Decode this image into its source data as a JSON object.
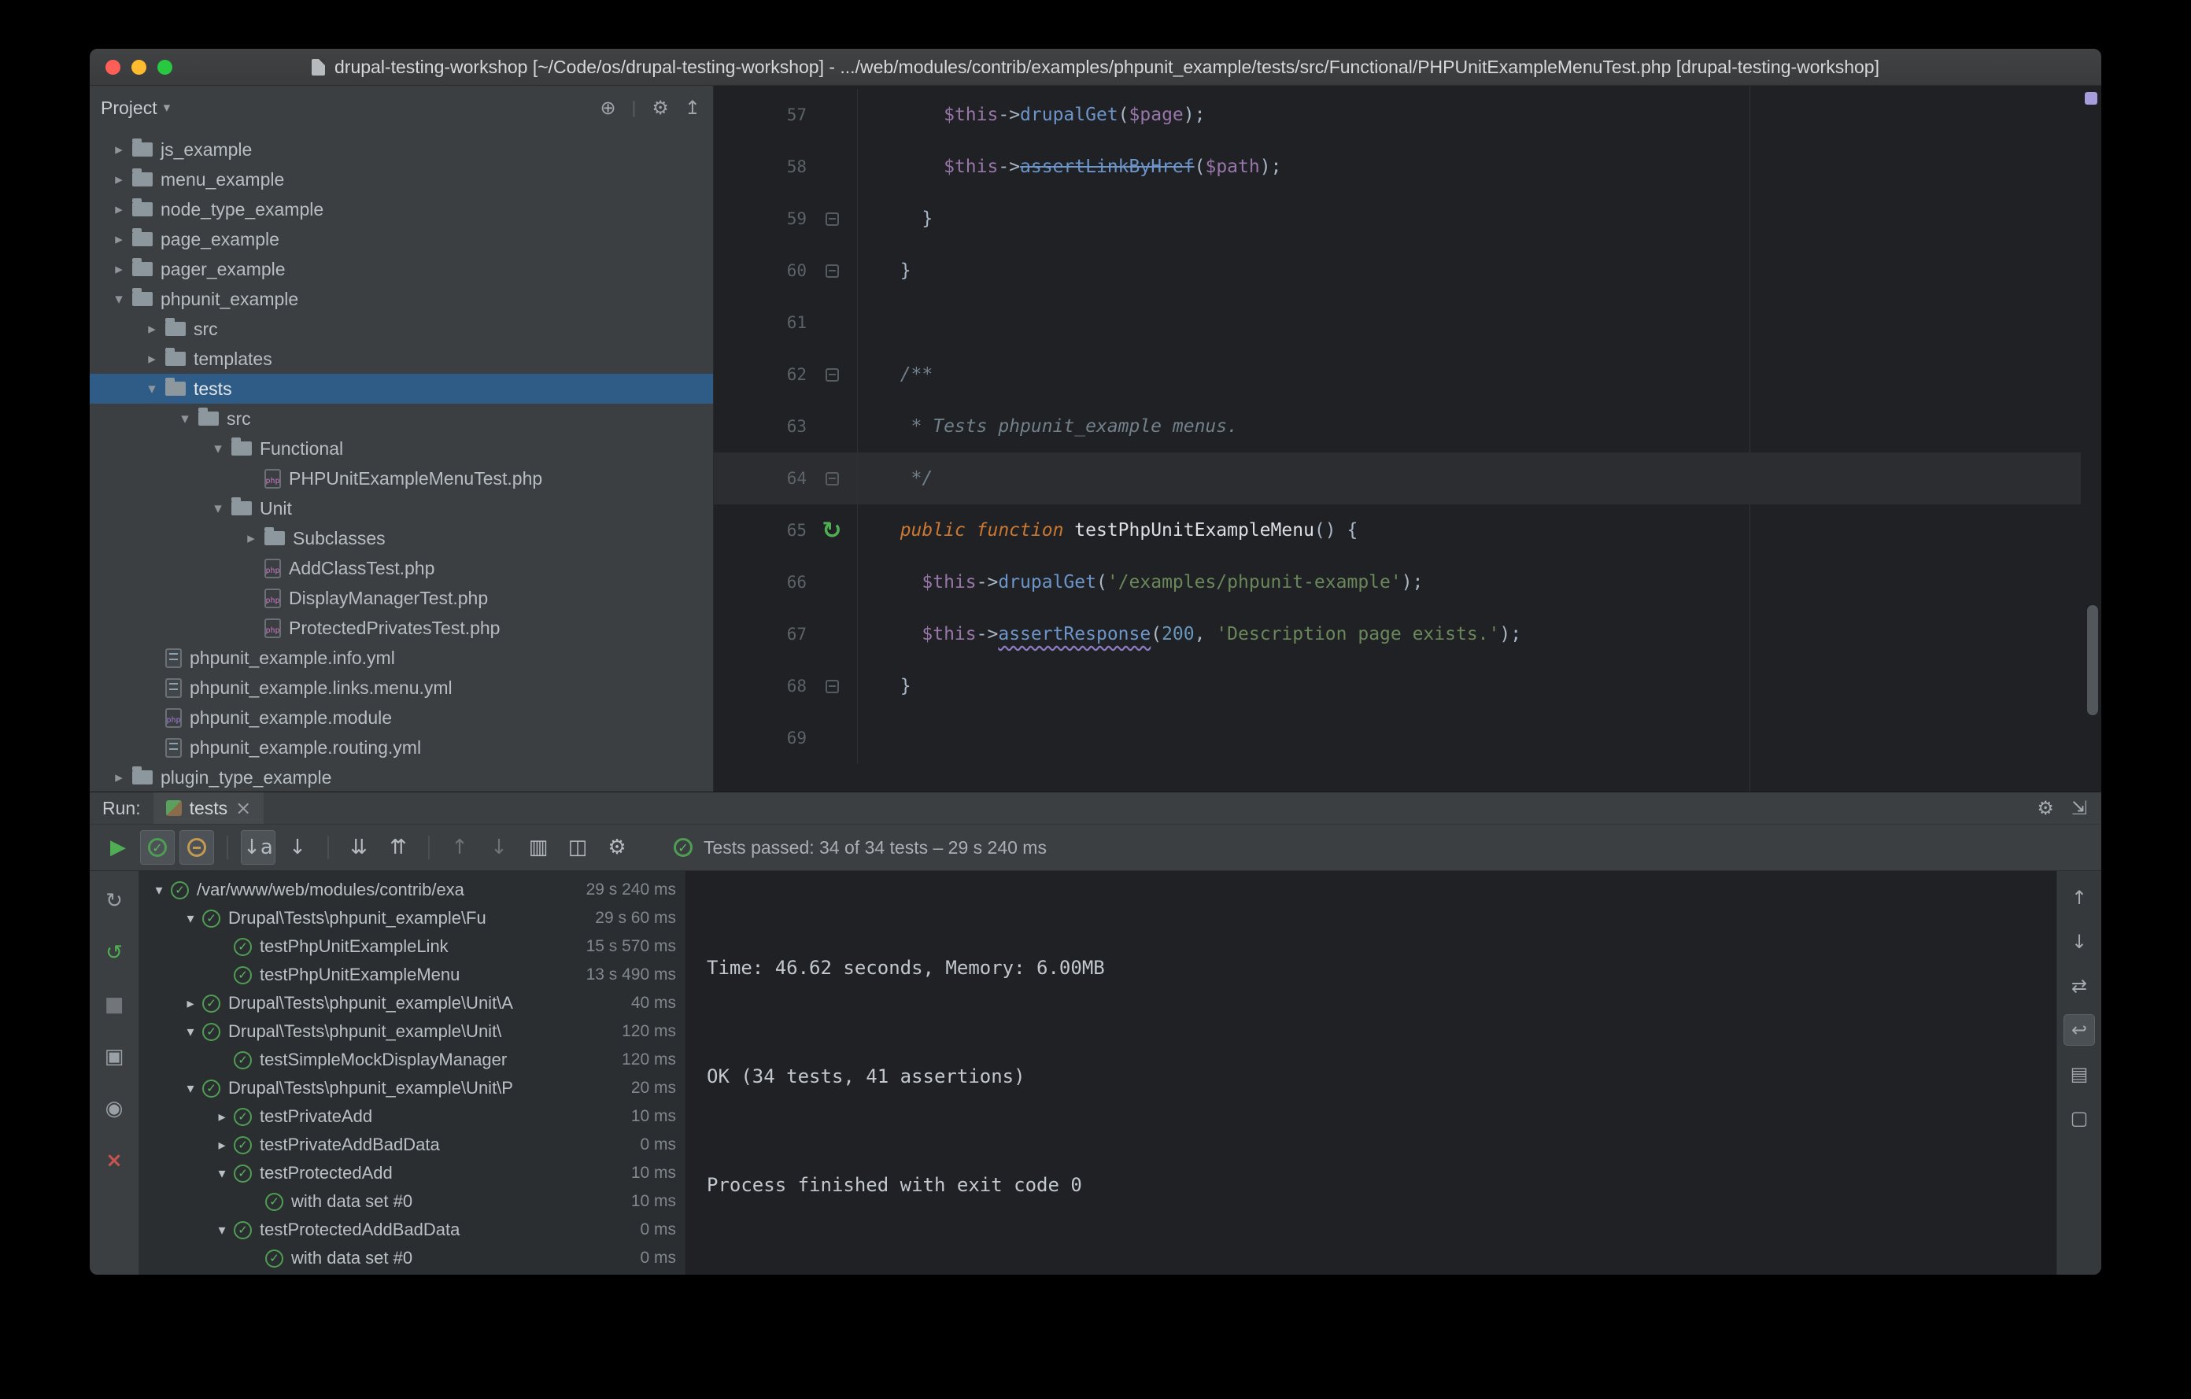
{
  "colors": {
    "selection_blue": "#2f5b87",
    "pass_green": "#4fae54",
    "string_green": "#6a8759",
    "keyword_orange": "#cc7832",
    "variable_purple": "#9876aa",
    "method_blue": "#6d95c9",
    "number_blue": "#6897bb",
    "comment_gray": "#71808a",
    "error_red": "#c75450",
    "warning_wavy": "#8d7cc4",
    "traffic_red": "#ff5f57",
    "traffic_yellow": "#febc2e",
    "traffic_green": "#28c840"
  },
  "window": {
    "title": "drupal-testing-workshop [~/Code/os/drupal-testing-workshop] - .../web/modules/contrib/examples/phpunit_example/tests/src/Functional/PHPUnitExampleMenuTest.php [drupal-testing-workshop]"
  },
  "project_panel": {
    "title": "Project",
    "caret_glyph": "▾",
    "header_icons": [
      {
        "name": "locate-file-icon",
        "glyph": "⊕"
      },
      {
        "name": "divider"
      },
      {
        "name": "settings-gear-icon",
        "glyph": "⚙"
      },
      {
        "name": "collapse-all-icon",
        "glyph": "↥"
      }
    ],
    "items": [
      {
        "label": "js_example",
        "depth": 0,
        "arrow": "collapsed",
        "icon": "folder"
      },
      {
        "label": "menu_example",
        "depth": 0,
        "arrow": "collapsed",
        "icon": "folder"
      },
      {
        "label": "node_type_example",
        "depth": 0,
        "arrow": "collapsed",
        "icon": "folder"
      },
      {
        "label": "page_example",
        "depth": 0,
        "arrow": "collapsed",
        "icon": "folder"
      },
      {
        "label": "pager_example",
        "depth": 0,
        "arrow": "collapsed",
        "icon": "folder"
      },
      {
        "label": "phpunit_example",
        "depth": 0,
        "arrow": "expanded",
        "icon": "folder"
      },
      {
        "label": "src",
        "depth": 1,
        "arrow": "collapsed",
        "icon": "folder"
      },
      {
        "label": "templates",
        "depth": 1,
        "arrow": "collapsed",
        "icon": "folder"
      },
      {
        "label": "tests",
        "depth": 1,
        "arrow": "expanded",
        "icon": "folder",
        "selected": true
      },
      {
        "label": "src",
        "depth": 2,
        "arrow": "expanded",
        "icon": "folder"
      },
      {
        "label": "Functional",
        "depth": 3,
        "arrow": "expanded",
        "icon": "folder"
      },
      {
        "label": "PHPUnitExampleMenuTest.php",
        "depth": 4,
        "arrow": "none",
        "icon": "php"
      },
      {
        "label": "Unit",
        "depth": 3,
        "arrow": "expanded",
        "icon": "folder"
      },
      {
        "label": "Subclasses",
        "depth": 4,
        "arrow": "collapsed",
        "icon": "folder"
      },
      {
        "label": "AddClassTest.php",
        "depth": 4,
        "arrow": "none",
        "icon": "php"
      },
      {
        "label": "DisplayManagerTest.php",
        "depth": 4,
        "arrow": "none",
        "icon": "php"
      },
      {
        "label": "ProtectedPrivatesTest.php",
        "depth": 4,
        "arrow": "none",
        "icon": "php"
      },
      {
        "label": "phpunit_example.info.yml",
        "depth": 1,
        "arrow": "none",
        "icon": "yml"
      },
      {
        "label": "phpunit_example.links.menu.yml",
        "depth": 1,
        "arrow": "none",
        "icon": "yml"
      },
      {
        "label": "phpunit_example.module",
        "depth": 1,
        "arrow": "none",
        "icon": "module"
      },
      {
        "label": "phpunit_example.routing.yml",
        "depth": 1,
        "arrow": "none",
        "icon": "yml"
      },
      {
        "label": "plugin_type_example",
        "depth": 0,
        "arrow": "collapsed",
        "icon": "folder"
      }
    ]
  },
  "editor": {
    "lines": [
      {
        "num": 57,
        "tokens": [
          {
            "t": "      ",
            "c": "pln"
          },
          {
            "t": "$this",
            "c": "var"
          },
          {
            "t": "->",
            "c": "pln"
          },
          {
            "t": "drupalGet",
            "c": "mth"
          },
          {
            "t": "(",
            "c": "pln"
          },
          {
            "t": "$page",
            "c": "var"
          },
          {
            "t": ");",
            "c": "pln"
          }
        ]
      },
      {
        "num": 58,
        "tokens": [
          {
            "t": "      ",
            "c": "pln"
          },
          {
            "t": "$this",
            "c": "var"
          },
          {
            "t": "->",
            "c": "pln"
          },
          {
            "t": "assertLinkByHref",
            "c": "mth strike"
          },
          {
            "t": "(",
            "c": "pln"
          },
          {
            "t": "$path",
            "c": "var"
          },
          {
            "t": ");",
            "c": "pln"
          }
        ]
      },
      {
        "num": 59,
        "gutter": "fold",
        "tokens": [
          {
            "t": "    }",
            "c": "pln"
          }
        ]
      },
      {
        "num": 60,
        "gutter": "fold",
        "tokens": [
          {
            "t": "  }",
            "c": "pln"
          }
        ]
      },
      {
        "num": 61,
        "tokens": []
      },
      {
        "num": 62,
        "gutter": "fold",
        "tokens": [
          {
            "t": "  /**",
            "c": "cmt"
          }
        ]
      },
      {
        "num": 63,
        "tokens": [
          {
            "t": "   * Tests phpunit_example menus.",
            "c": "cmt"
          }
        ]
      },
      {
        "num": 64,
        "gutter": "fold",
        "caret": true,
        "tokens": [
          {
            "t": "   */",
            "c": "cmt"
          }
        ]
      },
      {
        "num": 65,
        "gutter": "run",
        "tokens": [
          {
            "t": "  ",
            "c": "pln"
          },
          {
            "t": "public function",
            "c": "kw"
          },
          {
            "t": " ",
            "c": "pln"
          },
          {
            "t": "testPhpUnitExampleMenu",
            "c": "fn"
          },
          {
            "t": "() {",
            "c": "pln"
          }
        ]
      },
      {
        "num": 66,
        "tokens": [
          {
            "t": "    ",
            "c": "pln"
          },
          {
            "t": "$this",
            "c": "var"
          },
          {
            "t": "->",
            "c": "pln"
          },
          {
            "t": "drupalGet",
            "c": "mth"
          },
          {
            "t": "(",
            "c": "pln"
          },
          {
            "t": "'/examples/phpunit-example'",
            "c": "str"
          },
          {
            "t": ");",
            "c": "pln"
          }
        ]
      },
      {
        "num": 67,
        "tokens": [
          {
            "t": "    ",
            "c": "pln"
          },
          {
            "t": "$this",
            "c": "var"
          },
          {
            "t": "->",
            "c": "pln"
          },
          {
            "t": "assertResponse",
            "c": "mth warn"
          },
          {
            "t": "(",
            "c": "pln"
          },
          {
            "t": "200",
            "c": "num"
          },
          {
            "t": ", ",
            "c": "pln"
          },
          {
            "t": "'Description page exists.'",
            "c": "str"
          },
          {
            "t": ");",
            "c": "pln"
          }
        ]
      },
      {
        "num": 68,
        "gutter": "fold",
        "tokens": [
          {
            "t": "  }",
            "c": "pln"
          }
        ]
      },
      {
        "num": 69,
        "tokens": []
      }
    ]
  },
  "run_panel": {
    "label": "Run:",
    "tab": {
      "label": "tests",
      "close_glyph": "×"
    },
    "header_icons": [
      {
        "name": "settings-gear-icon",
        "glyph": "⚙"
      },
      {
        "name": "hide-panel-icon",
        "glyph": "⇲"
      }
    ],
    "toolbar": [
      {
        "name": "rerun-tests-button",
        "glyph": "play"
      },
      {
        "name": "show-passed-toggle",
        "glyph": "check-circle",
        "state": "toggled"
      },
      {
        "name": "show-ignored-toggle",
        "glyph": "ignored-circle",
        "state": "toggled"
      },
      {
        "name": "separator"
      },
      {
        "name": "sort-alphabetically-toggle",
        "glyph": "sort-alpha",
        "state": "toggled"
      },
      {
        "name": "sort-by-duration-toggle",
        "glyph": "sort-duration"
      },
      {
        "name": "separator"
      },
      {
        "name": "expand-all-button",
        "glyph": "expand-all"
      },
      {
        "name": "collapse-all-button",
        "glyph": "collapse-all"
      },
      {
        "name": "separator"
      },
      {
        "name": "previous-failed-test-button",
        "glyph": "arrow-up",
        "state": "disabled"
      },
      {
        "name": "next-failed-test-button",
        "glyph": "arrow-down",
        "state": "disabled"
      },
      {
        "name": "import-test-results-button",
        "glyph": "import"
      },
      {
        "name": "coverage-button",
        "glyph": "coverage"
      },
      {
        "name": "test-settings-button",
        "glyph": "gear"
      }
    ],
    "status": {
      "text": "Tests passed: 34 of 34 tests – 29 s 240 ms"
    },
    "left_strip": [
      {
        "name": "rerun-icon",
        "glyph": "rerun"
      },
      {
        "name": "rerun-failed-tests-icon",
        "glyph": "rerun-failed",
        "state": "success"
      },
      {
        "name": "stop-icon",
        "glyph": "stop",
        "state": "disabled"
      },
      {
        "name": "console-view-icon",
        "glyph": "console"
      },
      {
        "name": "pin-tab-icon",
        "glyph": "pin"
      },
      {
        "name": "close-tab-icon",
        "glyph": "close",
        "state": "danger"
      }
    ],
    "right_strip": [
      {
        "name": "scroll-up-icon",
        "glyph": "arrow-up"
      },
      {
        "name": "scroll-down-icon",
        "glyph": "arrow-down"
      },
      {
        "name": "navigate-icon",
        "glyph": "navigate"
      },
      {
        "name": "soft-wrap-icon",
        "glyph": "soft-wrap",
        "state": "toggled"
      },
      {
        "name": "print-icon",
        "glyph": "print"
      },
      {
        "name": "clear-console-icon",
        "glyph": "clear"
      }
    ],
    "tree": [
      {
        "label": "/var/www/web/modules/contrib/exa",
        "time": "29 s 240 ms",
        "depth": 0,
        "arrow": "expanded"
      },
      {
        "label": "Drupal\\Tests\\phpunit_example\\Fu",
        "time": "29 s 60 ms",
        "depth": 1,
        "arrow": "expanded"
      },
      {
        "label": "testPhpUnitExampleLink",
        "time": "15 s 570 ms",
        "depth": 2,
        "arrow": "none"
      },
      {
        "label": "testPhpUnitExampleMenu",
        "time": "13 s 490 ms",
        "depth": 2,
        "arrow": "none"
      },
      {
        "label": "Drupal\\Tests\\phpunit_example\\Unit\\A",
        "time": "40 ms",
        "depth": 1,
        "arrow": "collapsed"
      },
      {
        "label": "Drupal\\Tests\\phpunit_example\\Unit\\",
        "time": "120 ms",
        "depth": 1,
        "arrow": "expanded"
      },
      {
        "label": "testSimpleMockDisplayManager",
        "time": "120 ms",
        "depth": 2,
        "arrow": "none"
      },
      {
        "label": "Drupal\\Tests\\phpunit_example\\Unit\\P",
        "time": "20 ms",
        "depth": 1,
        "arrow": "expanded"
      },
      {
        "label": "testPrivateAdd",
        "time": "10 ms",
        "depth": 2,
        "arrow": "collapsed"
      },
      {
        "label": "testPrivateAddBadData",
        "time": "0 ms",
        "depth": 2,
        "arrow": "collapsed"
      },
      {
        "label": "testProtectedAdd",
        "time": "10 ms",
        "depth": 2,
        "arrow": "expanded"
      },
      {
        "label": "with data set #0",
        "time": "10 ms",
        "depth": 3,
        "arrow": "none"
      },
      {
        "label": "testProtectedAddBadData",
        "time": "0 ms",
        "depth": 2,
        "arrow": "expanded"
      },
      {
        "label": "with data set #0",
        "time": "0 ms",
        "depth": 3,
        "arrow": "none"
      }
    ],
    "console": [
      "Time: 46.62 seconds, Memory: 6.00MB",
      "",
      "",
      "OK (34 tests, 41 assertions)",
      "",
      "",
      "Process finished with exit code 0"
    ]
  }
}
